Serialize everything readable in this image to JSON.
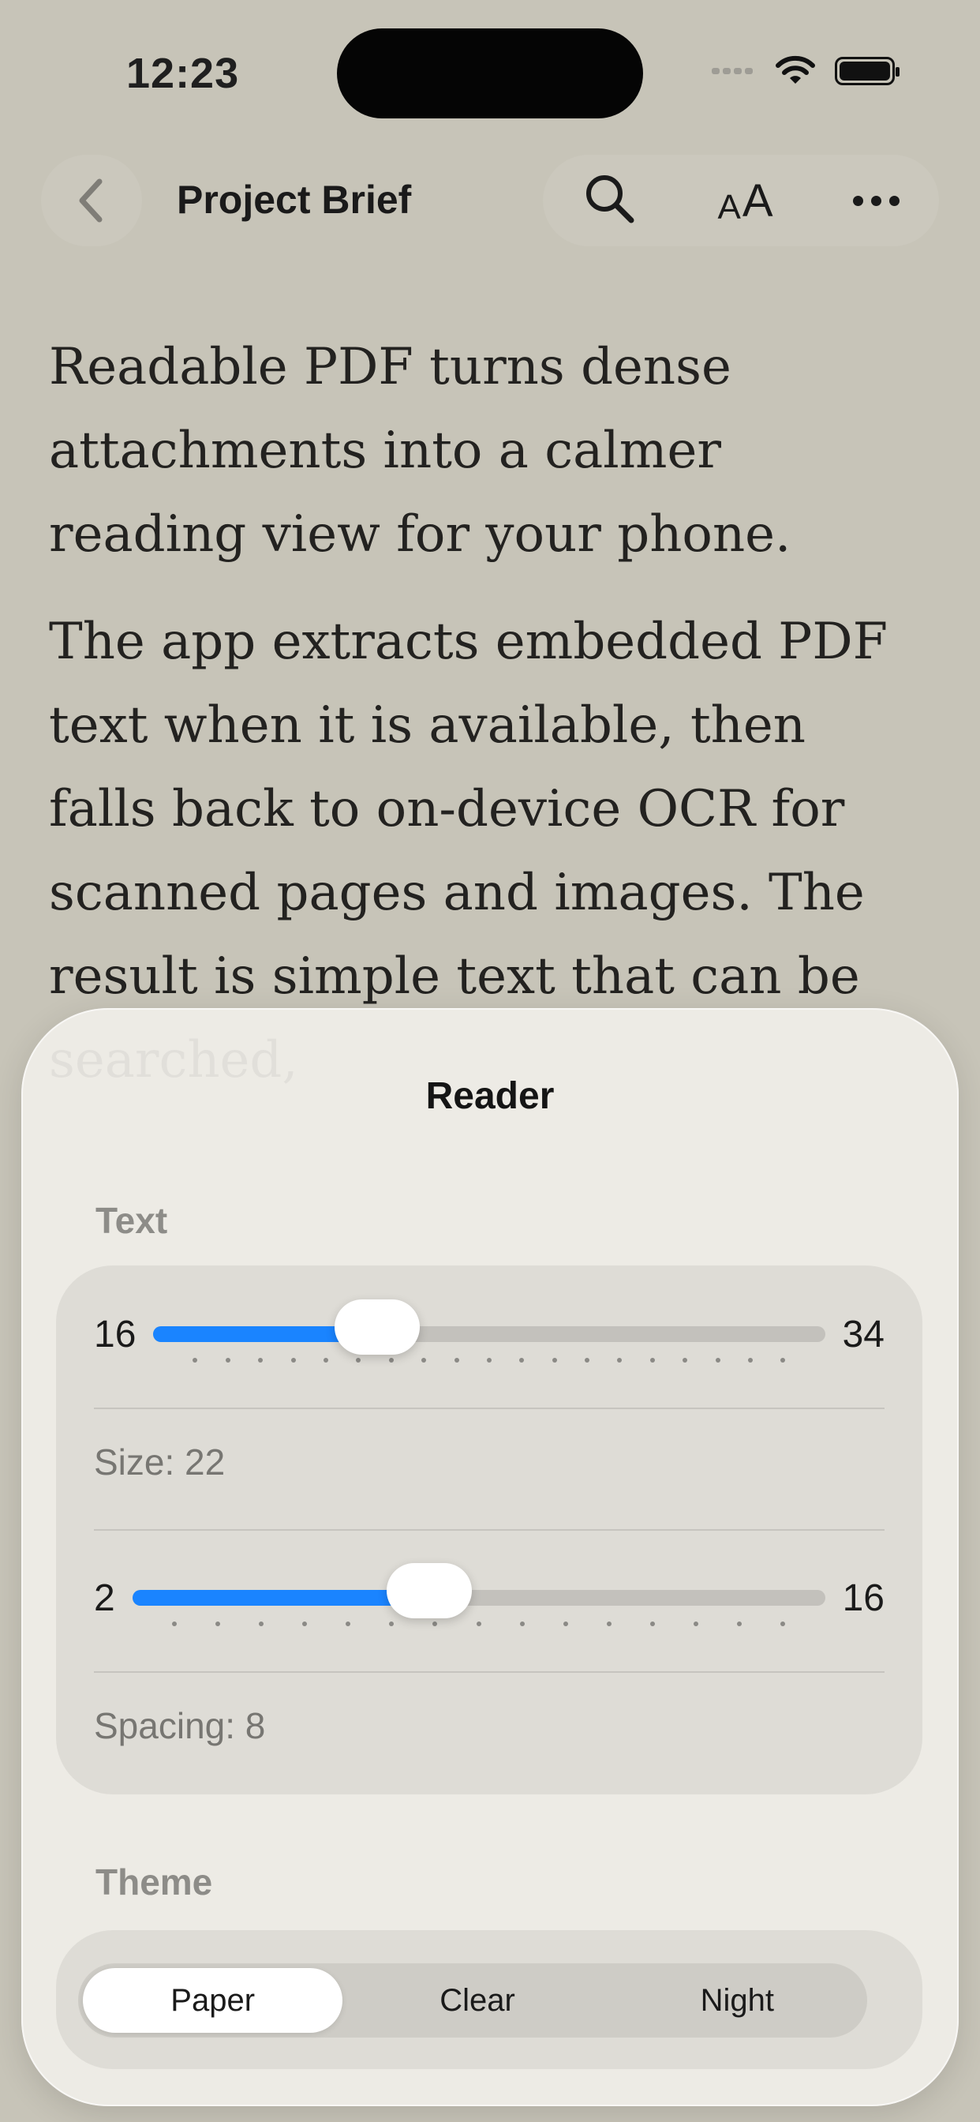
{
  "status": {
    "time": "12:23"
  },
  "nav": {
    "title": "Project Brief"
  },
  "article": {
    "paragraphs": [
      "Readable PDF turns dense attachments into a calmer reading view for your phone.",
      "The app extracts embedded PDF text when it is available, then falls back to on-device OCR for scanned pages and images. The result is simple text that can be searched,"
    ]
  },
  "sheet": {
    "title": "Reader",
    "text_section": "Text",
    "size_slider": {
      "min": "16",
      "max": "34",
      "value": 22,
      "label": "Size: 22"
    },
    "spacing_slider": {
      "min": "2",
      "max": "16",
      "value": 8,
      "label": "Spacing: 8"
    },
    "theme_section": "Theme",
    "themes": [
      {
        "label": "Paper",
        "selected": true
      },
      {
        "label": "Clear",
        "selected": false
      },
      {
        "label": "Night",
        "selected": false
      }
    ]
  },
  "colors": {
    "accent": "#1a84ff",
    "background": "#c7c4b8",
    "sheet": "#f0eee8"
  }
}
